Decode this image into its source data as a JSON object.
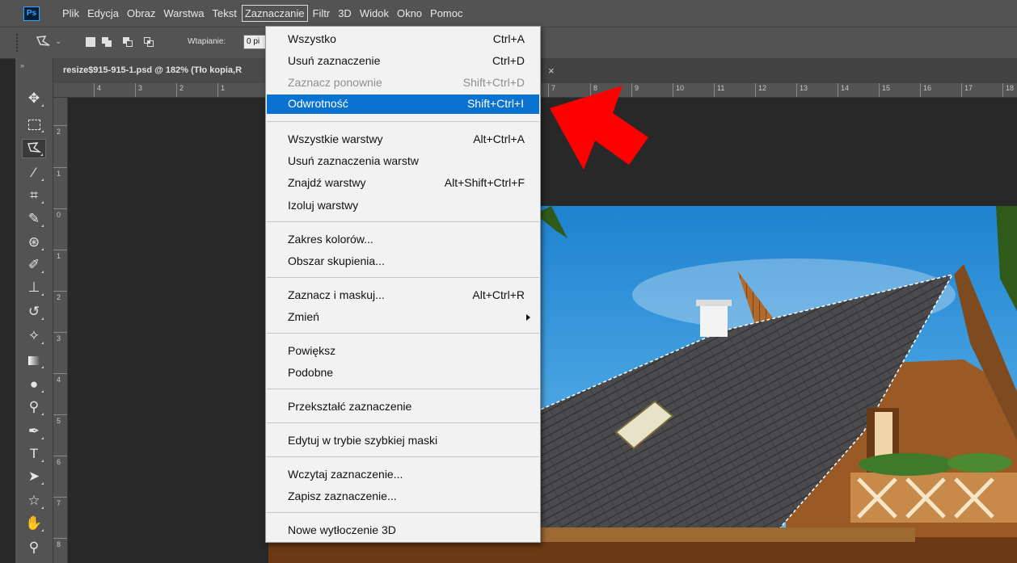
{
  "app": {
    "logo": "Ps"
  },
  "menubar": {
    "items": [
      "Plik",
      "Edycja",
      "Obraz",
      "Warstwa",
      "Tekst",
      "Zaznaczanie",
      "Filtr",
      "3D",
      "Widok",
      "Okno",
      "Pomoc"
    ],
    "active": "Zaznaczanie"
  },
  "options": {
    "feather_label": "Wtapianie:",
    "feather_value": "0 pi"
  },
  "document": {
    "tab_title": "resize$915-915-1.psd @ 182% (Tło kopia,R",
    "close_glyph": "×"
  },
  "rulers": {
    "top_labels": [
      "4",
      "3",
      "2",
      "1",
      "7",
      "8",
      "9",
      "10",
      "11",
      "12",
      "13",
      "14",
      "15",
      "16",
      "17",
      "18"
    ],
    "left_labels": [
      "2",
      "1",
      "0",
      "1",
      "2",
      "3",
      "4",
      "5",
      "6",
      "7",
      "8"
    ]
  },
  "tools": [
    "move-icon",
    "marquee-icon",
    "lasso-icon",
    "magic-wand-icon",
    "crop-icon",
    "eyedropper-icon",
    "healing-icon",
    "brush-icon",
    "stamp-icon",
    "history-brush-icon",
    "eraser-icon",
    "gradient-icon",
    "blur-icon",
    "dodge-icon",
    "pen-icon",
    "type-icon",
    "path-selection-icon",
    "shape-icon",
    "hand-icon",
    "zoom-icon"
  ],
  "dropdown": {
    "items": [
      {
        "label": "Wszystko",
        "shortcut": "Ctrl+A"
      },
      {
        "label": "Usuń zaznaczenie",
        "shortcut": "Ctrl+D"
      },
      {
        "label": "Zaznacz ponownie",
        "shortcut": "Shift+Ctrl+D",
        "disabled": true
      },
      {
        "label": "Odwrotność",
        "shortcut": "Shift+Ctrl+I",
        "highlight": true
      },
      {
        "label": "Wszystkie warstwy",
        "shortcut": "Alt+Ctrl+A"
      },
      {
        "label": "Usuń zaznaczenia warstw",
        "shortcut": ""
      },
      {
        "label": "Znajdź warstwy",
        "shortcut": "Alt+Shift+Ctrl+F"
      },
      {
        "label": "Izoluj warstwy",
        "shortcut": ""
      },
      {
        "label": "Zakres kolorów...",
        "shortcut": ""
      },
      {
        "label": "Obszar skupienia...",
        "shortcut": ""
      },
      {
        "label": "Zaznacz i maskuj...",
        "shortcut": "Alt+Ctrl+R"
      },
      {
        "label": "Zmień",
        "shortcut": "",
        "submenu": true
      },
      {
        "label": "Powiększ",
        "shortcut": ""
      },
      {
        "label": "Podobne",
        "shortcut": ""
      },
      {
        "label": "Przekształć zaznaczenie",
        "shortcut": ""
      },
      {
        "label": "Edytuj w trybie szybkiej maski",
        "shortcut": ""
      },
      {
        "label": "Wczytaj zaznaczenie...",
        "shortcut": ""
      },
      {
        "label": "Zapisz zaznaczenie...",
        "shortcut": ""
      },
      {
        "label": "Nowe wytłoczenie 3D",
        "shortcut": ""
      }
    ]
  },
  "colors": {
    "highlight": "#0a72d1",
    "arrow": "#ff0000",
    "sky": "#2f9be0",
    "roof": "#4a4a4c",
    "wood": "#b06a2e"
  }
}
